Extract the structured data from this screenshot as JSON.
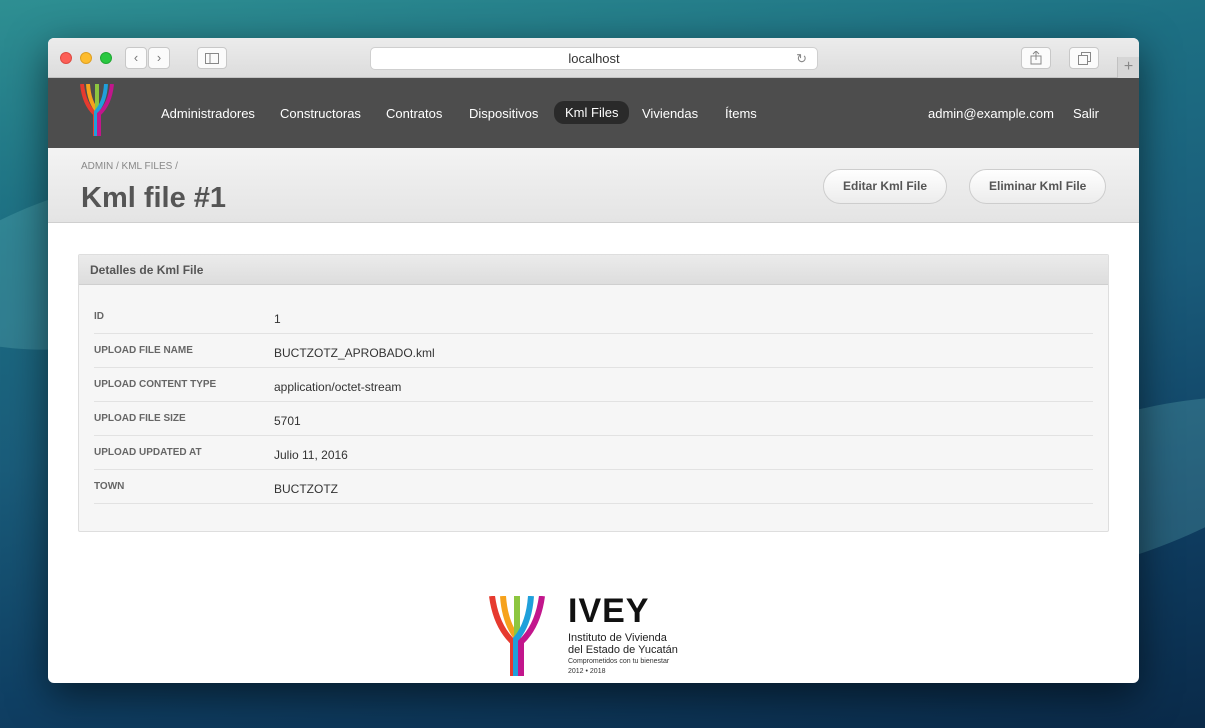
{
  "browser": {
    "url": "localhost"
  },
  "nav": {
    "items": [
      {
        "label": "Administradores"
      },
      {
        "label": "Constructoras"
      },
      {
        "label": "Contratos"
      },
      {
        "label": "Dispositivos"
      },
      {
        "label": "Kml Files",
        "active": true
      },
      {
        "label": "Viviendas"
      },
      {
        "label": "Ítems"
      }
    ],
    "user_email": "admin@example.com",
    "logout_label": "Salir"
  },
  "header": {
    "breadcrumb": "ADMIN / KML FILES /",
    "title": "Kml file #1",
    "edit_label": "Editar Kml File",
    "delete_label": "Eliminar Kml File"
  },
  "panel": {
    "title": "Detalles de Kml File",
    "rows": [
      {
        "key": "ID",
        "value": "1"
      },
      {
        "key": "UPLOAD FILE NAME",
        "value": "BUCTZOTZ_APROBADO.kml"
      },
      {
        "key": "UPLOAD CONTENT TYPE",
        "value": "application/octet-stream"
      },
      {
        "key": "UPLOAD FILE SIZE",
        "value": "5701"
      },
      {
        "key": "UPLOAD UPDATED AT",
        "value": "Julio 11, 2016"
      },
      {
        "key": "TOWN",
        "value": "BUCTZOTZ"
      }
    ]
  },
  "footer": {
    "brand": "IVEY",
    "line1": "Instituto de Vivienda",
    "line2": "del Estado de Yucatán",
    "tagline": "Comprometidos con tu bienestar",
    "years": "2012 • 2018"
  },
  "colors": {
    "navbar": "#4d4d4d",
    "active_pill": "#2a2a2a",
    "logo_stripes": [
      "#e63a2f",
      "#f6a21c",
      "#8dc63f",
      "#1fa0db",
      "#c2168c"
    ]
  },
  "icons": [
    "back-icon",
    "forward-icon",
    "sidebar-icon",
    "reload-icon",
    "share-icon",
    "tabs-icon",
    "new-tab-icon"
  ]
}
